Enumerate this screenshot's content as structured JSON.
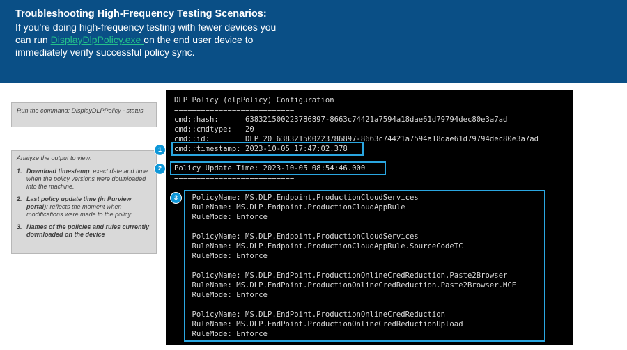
{
  "banner": {
    "title": "Troubleshooting High-Frequency Testing Scenarios:",
    "line1": "If you’re doing high-frequency testing with fewer devices you",
    "line2_prefix": "can run ",
    "link": "DisplayDlpPolicy.exe ",
    "line2_suffix": "on the end user device to",
    "line3": "immediately verify successful policy sync."
  },
  "callouts": {
    "command": "Run the command: DisplayDLPPolicy - status",
    "analyze_intro": "Analyze the output to view:",
    "items": [
      {
        "num": "1.",
        "bold": "Download timestamp",
        "text": ": exact date and time when the policy versions were downloaded into the machine."
      },
      {
        "num": "2.",
        "bold": "Last policy update time (in Purview portal):",
        "text": " reflects the moment when modifications were made to the policy."
      },
      {
        "num": "3.",
        "bold": "Names of the policies and rules currently downloaded on the device",
        "text": ""
      }
    ]
  },
  "terminal": {
    "lines": [
      "DLP Policy (dlpPolicy) Configuration",
      "===========================",
      "cmd::hash:      638321500223786897-8663c74421a7594a18dae61d79794dec80e3a7ad",
      "cmd::cmdtype:   20",
      "cmd::id:        DLP_20_638321500223786897-8663c74421a7594a18dae61d79794dec80e3a7ad",
      "cmd::timestamp: 2023-10-05 17:47:02.378",
      "",
      "Policy Update Time: 2023-10-05 08:54:46.000",
      "===========================",
      "",
      "    PolicyName: MS.DLP.Endpoint.ProductionCloudServices",
      "    RuleName: MS.DLP.Endpoint.ProductionCloudAppRule",
      "    RuleMode: Enforce",
      "",
      "    PolicyName: MS.DLP.Endpoint.ProductionCloudServices",
      "    RuleName: MS.DLP.Endpoint.ProductionCloudAppRule.SourceCodeTC",
      "    RuleMode: Enforce",
      "",
      "    PolicyName: MS.DLP.EndPoint.ProductionOnlineCredReduction.Paste2Browser",
      "    RuleName: MS.DLP.EndPoint.ProductionOnlineCredReduction.Paste2Browser.MCE",
      "    RuleMode: Enforce",
      "",
      "    PolicyName: MS.DLP.EndPoint.ProductionOnlineCredReduction",
      "    RuleName: MS.DLP.EndPoint.ProductionOnlineCredReductionUpload",
      "    RuleMode: Enforce"
    ]
  },
  "badges": [
    "1",
    "2",
    "3"
  ],
  "colors": {
    "banner_bg": "#0a4f86",
    "link": "#23c08a",
    "highlight": "#2aa6e0",
    "badge": "#0e97d8"
  }
}
